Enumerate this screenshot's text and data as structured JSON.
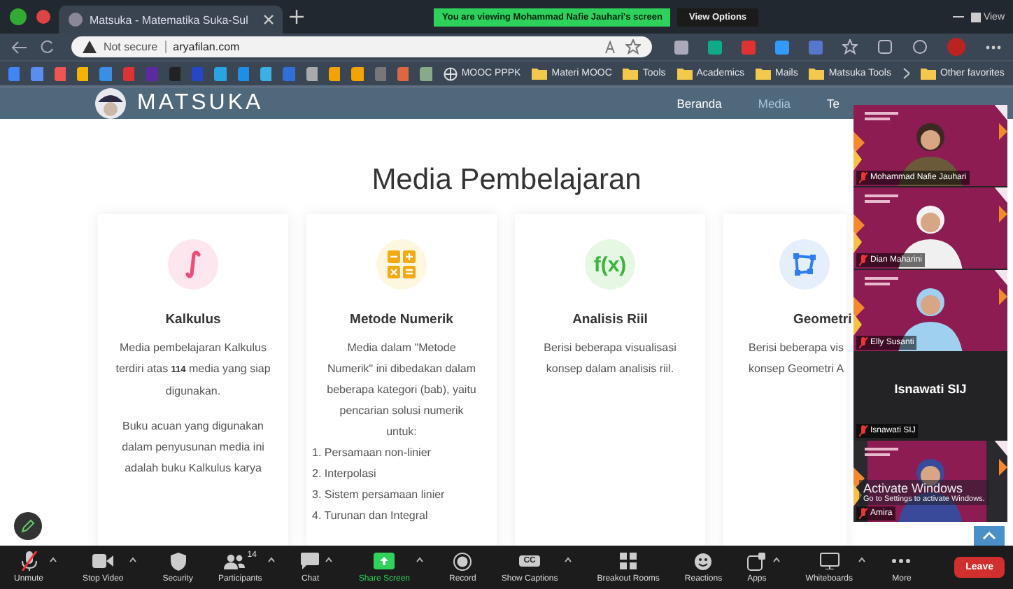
{
  "browser": {
    "tab": {
      "title": "Matsuka - Matematika Suka-Sul"
    },
    "address": {
      "security": "Not secure",
      "url": "aryafilan.com"
    },
    "bookmarks": [
      {
        "label": "MOOC PPPK",
        "kind": "site"
      },
      {
        "label": "Materi MOOC",
        "kind": "folder"
      },
      {
        "label": "Tools",
        "kind": "folder"
      },
      {
        "label": "Academics",
        "kind": "folder"
      },
      {
        "label": "Mails",
        "kind": "folder"
      },
      {
        "label": "Matsuka Tools",
        "kind": "folder"
      },
      {
        "label": "Other favorites",
        "kind": "folder"
      }
    ]
  },
  "share_banner": {
    "text": "You are viewing Mohammad Nafie Jauhari's screen",
    "options": "View Options"
  },
  "window_controls": {
    "view": "View"
  },
  "site": {
    "brand": "MATSUKA",
    "nav": [
      {
        "label": "Beranda",
        "selected": false
      },
      {
        "label": "Media",
        "selected": true
      },
      {
        "label": "Te",
        "selected": false
      }
    ],
    "heading": "Media Pembelajaran",
    "cards": [
      {
        "kind": "integral",
        "title": "Kalkulus",
        "paragraphs": [
          "Media pembelajaran Kalkulus terdiri atas **114** media yang siap digunakan.",
          "Buku acuan yang digunakan dalam penyusunan media ini adalah buku Kalkulus karya"
        ]
      },
      {
        "kind": "calculator",
        "title": "Metode Numerik",
        "paragraphs": [
          "Media dalam \"Metode Numerik\" ini dibedakan dalam beberapa kategori (bab), yaitu pencarian solusi numerik untuk:"
        ],
        "list": [
          "1. Persamaan non-linier",
          "2. Interpolasi",
          "3. Sistem persamaan linier",
          "4. Turunan dan Integral"
        ]
      },
      {
        "kind": "function",
        "icon_text": "f(x)",
        "title": "Analisis Riil",
        "paragraphs": [
          "Berisi beberapa visualisasi konsep dalam analisis riil."
        ]
      },
      {
        "kind": "shape",
        "title": "Geometri",
        "paragraphs": [
          "Berisi beberapa vis",
          "konsep Geometri A"
        ]
      }
    ]
  },
  "participants": [
    {
      "kind": "video",
      "name": "Mohammad Nafie Jauhari"
    },
    {
      "kind": "video",
      "name": "Dian Maharini"
    },
    {
      "kind": "video",
      "name": "Elly Susanti"
    },
    {
      "kind": "name",
      "name": "Isnawati SIJ",
      "label": "Isnawati SIJ"
    },
    {
      "kind": "video",
      "name": "Amira"
    }
  ],
  "windows_notice": {
    "title": "Activate Windows",
    "text": "Go to Settings to activate Windows."
  },
  "toolbar": [
    {
      "kind": "mic-off",
      "label": "Unmute",
      "caret": true
    },
    {
      "kind": "camera",
      "label": "Stop Video",
      "caret": true
    },
    {
      "kind": "shield",
      "label": "Security",
      "caret": false
    },
    {
      "kind": "people",
      "label": "Participants",
      "count": "14",
      "caret": true
    },
    {
      "kind": "chat",
      "label": "Chat",
      "caret": true
    },
    {
      "kind": "share",
      "label": "Share Screen",
      "caret": true
    },
    {
      "kind": "record",
      "label": "Record",
      "caret": false
    },
    {
      "kind": "captions",
      "icon_text": "CC",
      "label": "Show Captions",
      "caret": true
    },
    {
      "kind": "grid",
      "label": "Breakout Rooms",
      "caret": false
    },
    {
      "kind": "emoji",
      "label": "Reactions",
      "caret": false
    },
    {
      "kind": "apps",
      "label": "Apps",
      "caret": true
    },
    {
      "kind": "board",
      "label": "Whiteboards",
      "caret": true
    },
    {
      "kind": "more",
      "label": "More",
      "caret": false
    }
  ],
  "leave": "Leave"
}
